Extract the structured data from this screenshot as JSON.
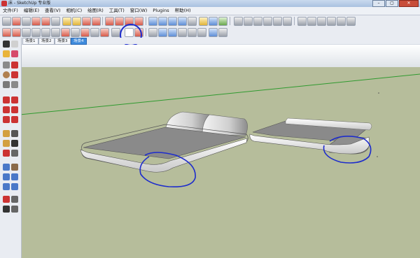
{
  "window": {
    "title": "床 - SketchUp 专业版"
  },
  "menu": [
    "文件(F)",
    "编辑(E)",
    "查看(V)",
    "相机(C)",
    "绘图(R)",
    "工具(T)",
    "窗口(W)",
    "Plugins",
    "帮助(H)"
  ],
  "scenes": {
    "tabs": [
      "场景1",
      "场景2",
      "场景3",
      "场景4"
    ],
    "active": "场景4"
  },
  "colors": {
    "sky": "#e8ebef",
    "ground": "#b6bd9b",
    "axis_green": "#2f9a2f",
    "annotation_blue": "#1d2ccc",
    "bed_top": "#8a8a8a",
    "bed_side": "#efefef"
  },
  "icons": {
    "selected_tool": "angle-bracket-icon"
  }
}
